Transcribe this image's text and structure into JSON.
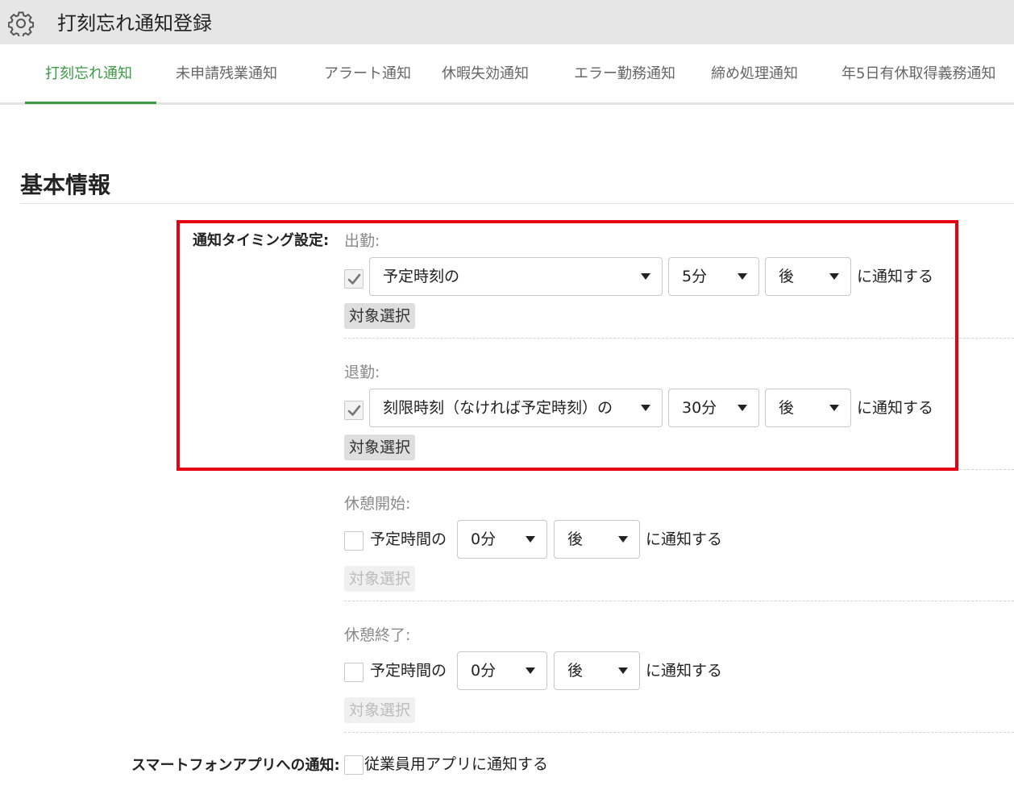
{
  "header": {
    "title": "打刻忘れ通知登録",
    "icon": "gear-icon"
  },
  "tabs": [
    {
      "label": "打刻忘れ通知",
      "active": true
    },
    {
      "label": "未申請残業通知",
      "active": false
    },
    {
      "label": "アラート通知",
      "active": false
    },
    {
      "label": "休暇失効通知",
      "active": false
    },
    {
      "label": "エラー勤務通知",
      "active": false
    },
    {
      "label": "締め処理通知",
      "active": false
    },
    {
      "label": "年5日有休取得義務通知",
      "active": false
    }
  ],
  "section": {
    "title": "基本情報"
  },
  "timing": {
    "label": "通知タイミング設定:",
    "rows": [
      {
        "sublabel": "出勤:",
        "checked": true,
        "base": "予定時刻の",
        "minutes": "5分",
        "direction": "後",
        "suffix": "に通知する",
        "target_button": "対象選択",
        "target_enabled": true
      },
      {
        "sublabel": "退勤:",
        "checked": true,
        "base": "刻限時刻（なければ予定時刻）の",
        "minutes": "30分",
        "direction": "後",
        "suffix": "に通知する",
        "target_button": "対象選択",
        "target_enabled": true
      },
      {
        "sublabel": "休憩開始:",
        "checked": false,
        "base": "予定時間の",
        "minutes": "0分",
        "direction": "後",
        "suffix": "に通知する",
        "target_button": "対象選択",
        "target_enabled": false
      },
      {
        "sublabel": "休憩終了:",
        "checked": false,
        "base": "予定時間の",
        "minutes": "0分",
        "direction": "後",
        "suffix": "に通知する",
        "target_button": "対象選択",
        "target_enabled": false
      }
    ]
  },
  "smartphone": {
    "label": "スマートフォンアプリへの通知:",
    "checkbox_label": "従業員用アプリに通知する",
    "checked": false
  },
  "colors": {
    "accent": "#3d9a46",
    "highlight": "#e60012",
    "header_bg": "#e6e6e6"
  }
}
